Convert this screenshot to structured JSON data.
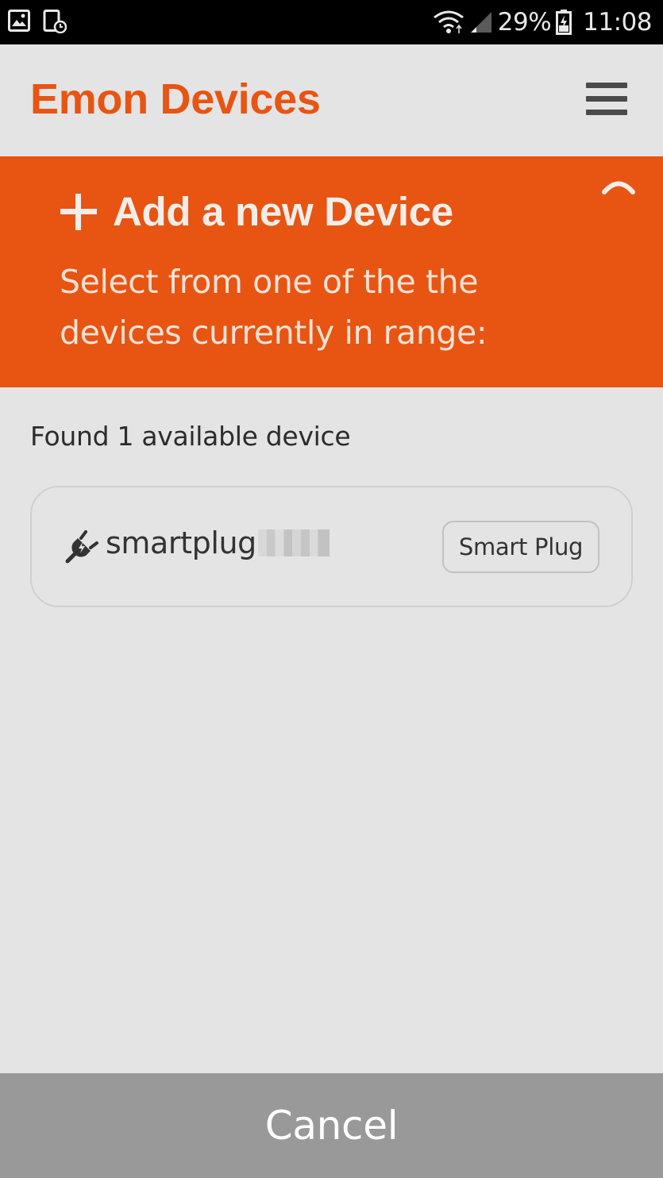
{
  "status_bar": {
    "icons": [
      "gallery-icon",
      "screenshot-icon",
      "wifi-icon",
      "signal-icon",
      "battery-icon"
    ],
    "battery": "29%",
    "time": "11:08"
  },
  "header": {
    "title": "Emon Devices",
    "menu_icon": "hamburger-menu-icon"
  },
  "banner": {
    "background": "#e85412",
    "title": "Add a new Device",
    "subtitle": "Select from one of the the devices currently in range:",
    "title_icon": "plus-icon",
    "collapse_icon": "chevron-up-icon"
  },
  "content": {
    "found_text": "Found 1 available device",
    "devices": [
      {
        "name": "smartplug",
        "icon": "plug-icon",
        "type": "Smart Plug"
      }
    ]
  },
  "footer": {
    "cancel_label": "Cancel"
  },
  "colors": {
    "accent": "#e85412",
    "background": "#e4e4e4",
    "cancel_bg": "#999999"
  }
}
